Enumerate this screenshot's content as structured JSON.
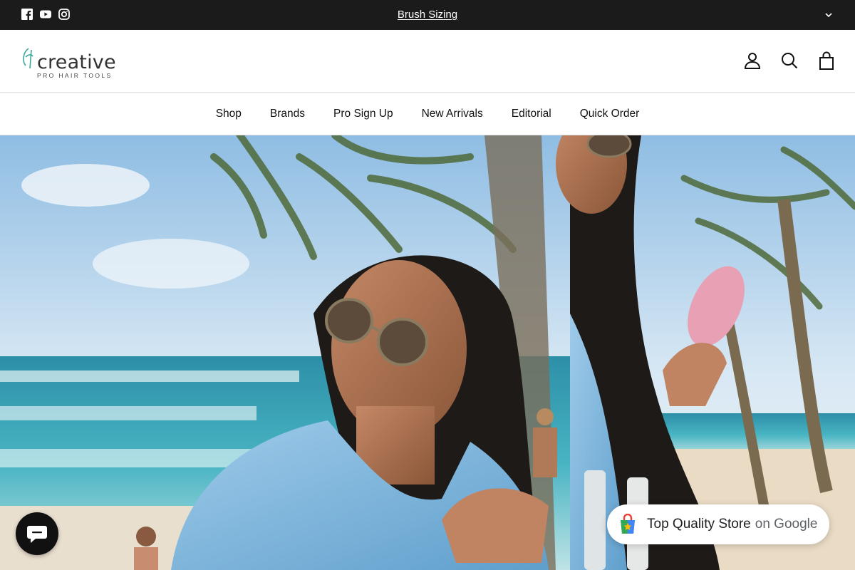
{
  "announcement": {
    "text": "Brush Sizing",
    "social_icons": [
      "facebook-icon",
      "youtube-icon",
      "instagram-icon"
    ]
  },
  "header": {
    "logo_word": "creative",
    "logo_sub": "PRO HAIR TOOLS",
    "icons": [
      "account-icon",
      "search-icon",
      "cart-icon"
    ]
  },
  "nav": {
    "items": [
      "Shop",
      "Brands",
      "Pro Sign Up",
      "New Arrivals",
      "Editorial",
      "Quick Order"
    ]
  },
  "hero": {
    "description_icon": "beach-hair-brush-photo"
  },
  "google_badge": {
    "label": "Top Quality Store",
    "suffix": "on Google"
  },
  "colors": {
    "topbar": "#1b1b1b",
    "accent_teal": "#3aa79b",
    "text": "#111111"
  }
}
